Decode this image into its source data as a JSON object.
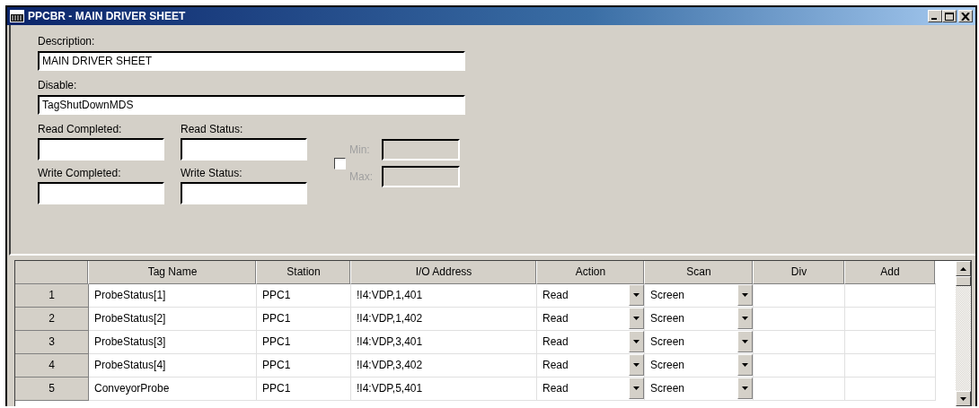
{
  "window": {
    "title": "PPCBR - MAIN DRIVER SHEET"
  },
  "form": {
    "description": {
      "label": "Description:",
      "value": "MAIN DRIVER SHEET"
    },
    "disable": {
      "label": "Disable:",
      "value": "TagShutDownMDS"
    },
    "read_completed": {
      "label": "Read Completed:"
    },
    "read_status": {
      "label": "Read Status:"
    },
    "write_completed": {
      "label": "Write Completed:"
    },
    "write_status": {
      "label": "Write Status:"
    },
    "range": {
      "checked": false,
      "disabled": true,
      "min_label": "Min:",
      "max_label": "Max:"
    }
  },
  "table": {
    "columns": [
      "Tag Name",
      "Station",
      "I/O Address",
      "Action",
      "Scan",
      "Div",
      "Add"
    ],
    "rows": [
      {
        "number": "1",
        "tag_name": "ProbeStatus[1]",
        "station": "PPC1",
        "io_address": "!I4:VDP,1,401",
        "action": "Read",
        "scan": "Screen"
      },
      {
        "number": "2",
        "tag_name": "ProbeStatus[2]",
        "station": "PPC1",
        "io_address": "!I4:VDP,1,402",
        "action": "Read",
        "scan": "Screen"
      },
      {
        "number": "3",
        "tag_name": "ProbeStatus[3]",
        "station": "PPC1",
        "io_address": "!I4:VDP,3,401",
        "action": "Read",
        "scan": "Screen"
      },
      {
        "number": "4",
        "tag_name": "ProbeStatus[4]",
        "station": "PPC1",
        "io_address": "!I4:VDP,3,402",
        "action": "Read",
        "scan": "Screen"
      },
      {
        "number": "5",
        "tag_name": "ConveyorProbe",
        "station": "PPC1",
        "io_address": "!I4:VDP,5,401",
        "action": "Read",
        "scan": "Screen"
      }
    ]
  }
}
